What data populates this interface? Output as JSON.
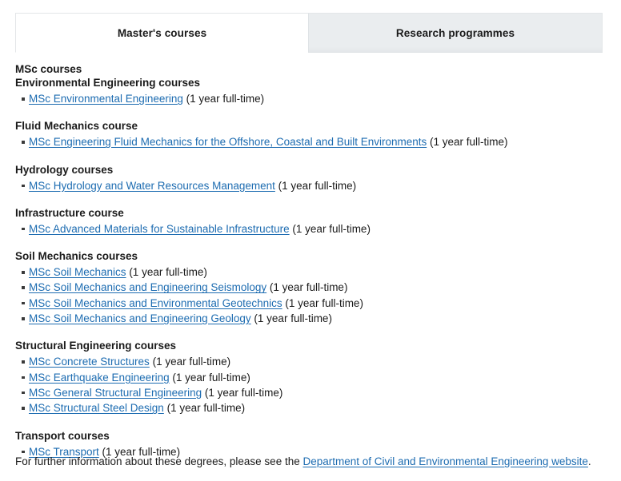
{
  "tabs": [
    {
      "label": "Master's courses",
      "active": true
    },
    {
      "label": "Research programmes",
      "active": false
    }
  ],
  "main": {
    "title": "MSc courses",
    "groups": [
      {
        "heading": "Environmental Engineering courses",
        "courses": [
          {
            "name": "MSc Environmental Engineering",
            "duration": "(1 year full-time)"
          }
        ]
      },
      {
        "heading": "Fluid Mechanics course",
        "courses": [
          {
            "name": "MSc Engineering Fluid Mechanics for the Offshore, Coastal and Built Environments",
            "duration": "(1 year full-time)"
          }
        ]
      },
      {
        "heading": "Hydrology courses",
        "courses": [
          {
            "name": "MSc Hydrology and Water Resources Management",
            "duration": "(1 year full-time)"
          }
        ]
      },
      {
        "heading": "Infrastructure course",
        "courses": [
          {
            "name": "MSc Advanced Materials for Sustainable Infrastructure",
            "duration": "(1 year full-time)"
          }
        ]
      },
      {
        "heading": "Soil Mechanics courses",
        "courses": [
          {
            "name": "MSc Soil Mechanics",
            "duration": "(1 year full-time)"
          },
          {
            "name": "MSc Soil Mechanics and Engineering Seismology",
            "duration": "(1 year full-time)"
          },
          {
            "name": "MSc Soil Mechanics and Environmental Geotechnics",
            "duration": "(1 year full-time)"
          },
          {
            "name": "MSc Soil Mechanics and Engineering Geology",
            "duration": "(1 year full-time)"
          }
        ]
      },
      {
        "heading": "Structural Engineering courses",
        "courses": [
          {
            "name": "MSc Concrete Structures",
            "duration": "(1 year full-time)"
          },
          {
            "name": "MSc Earthquake Engineering",
            "duration": "(1 year full-time)"
          },
          {
            "name": "MSc General Structural Engineering",
            "duration": "(1 year full-time)"
          },
          {
            "name": "MSc Structural Steel Design",
            "duration": "(1 year full-time)"
          }
        ]
      },
      {
        "heading": "Transport courses",
        "courses": [
          {
            "name": "MSc Transport",
            "duration": "(1 year full-time)"
          }
        ]
      }
    ]
  },
  "footer": {
    "prefix": "For further information about these degrees, please see the ",
    "link_text": "Department of Civil and Environmental Engineering website",
    "suffix": "."
  },
  "colors": {
    "link": "#1d6cb1",
    "text": "#1a1a1a",
    "tab_inactive_bg": "#e9ecef",
    "tab_active_bg": "#ffffff",
    "tab_border": "#e3e6e8",
    "page_bg": "#ffffff"
  }
}
